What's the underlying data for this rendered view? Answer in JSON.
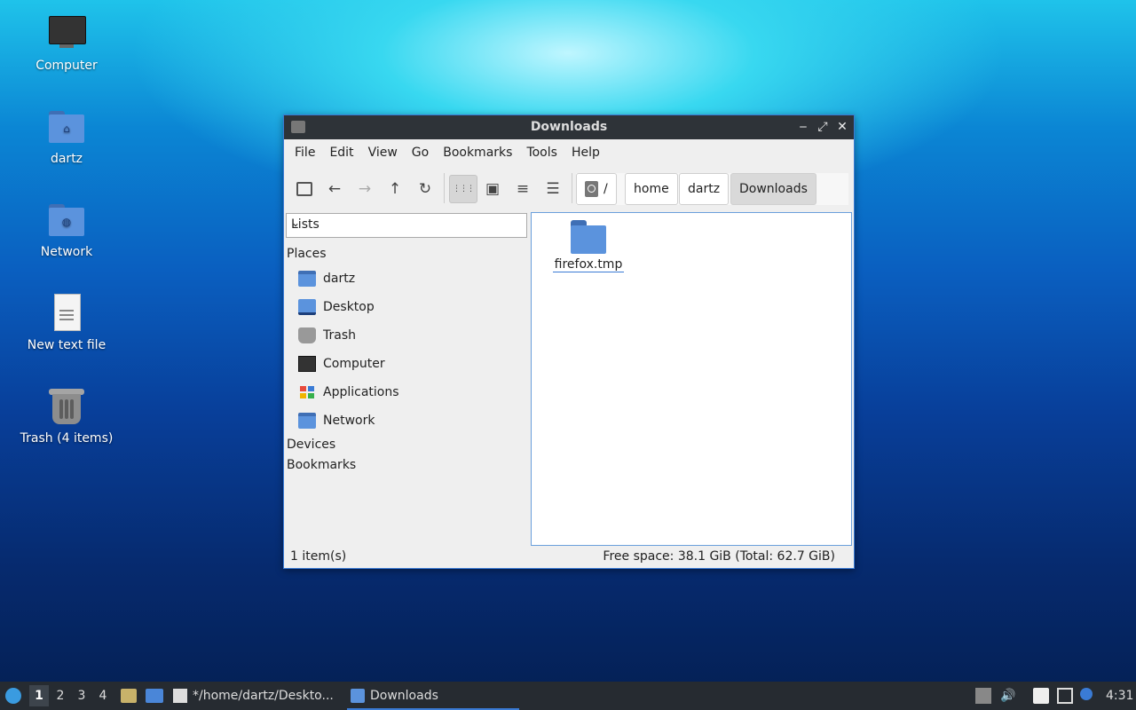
{
  "desktop": {
    "icons": [
      {
        "label": "Computer",
        "icon": "computer-icon"
      },
      {
        "label": "dartz",
        "icon": "home-folder-icon"
      },
      {
        "label": "Network",
        "icon": "network-folder-icon"
      },
      {
        "label": "New text file",
        "icon": "text-file-icon"
      },
      {
        "label": "Trash (4 items)",
        "icon": "trash-icon"
      }
    ]
  },
  "window": {
    "title": "Downloads",
    "controls": {
      "minimize": "‒",
      "maximize": "⤢",
      "close": "✕"
    },
    "menu": [
      "File",
      "Edit",
      "View",
      "Go",
      "Bookmarks",
      "Tools",
      "Help"
    ],
    "toolbar": {
      "icons": [
        "new-tab-icon",
        "back-icon",
        "forward-icon",
        "up-icon",
        "reload-icon",
        "icon-view-icon",
        "thumbnail-view-icon",
        "compact-view-icon",
        "detailed-view-icon"
      ],
      "glyphs": {
        "back": "←",
        "forward": "→",
        "up": "↑",
        "reload": "↻",
        "icon_view": "⋮⋮⋮",
        "thumb_view": "▣",
        "compact_view": "≡",
        "detail_view": "☰"
      }
    },
    "breadcrumb": {
      "root": "/",
      "items": [
        "home",
        "dartz",
        "Downloads"
      ]
    },
    "sidebar": {
      "selector": "Lists",
      "places_heading": "Places",
      "places": [
        {
          "label": "dartz",
          "icon": "home-folder-icon"
        },
        {
          "label": "Desktop",
          "icon": "desktop-icon"
        },
        {
          "label": "Trash",
          "icon": "trash-icon"
        },
        {
          "label": "Computer",
          "icon": "computer-icon"
        },
        {
          "label": "Applications",
          "icon": "applications-icon"
        },
        {
          "label": "Network",
          "icon": "network-icon"
        }
      ],
      "devices_heading": "Devices",
      "bookmarks_heading": "Bookmarks"
    },
    "files": [
      {
        "name": "firefox.tmp",
        "icon": "folder-icon"
      }
    ],
    "status": {
      "count": "1 item(s)",
      "space": "Free space: 38.1 GiB (Total: 62.7 GiB)"
    }
  },
  "taskbar": {
    "workspaces": [
      "1",
      "2",
      "3",
      "4"
    ],
    "active_workspace": "1",
    "tasks": [
      {
        "label": "*/home/dartz/Deskto...",
        "icon": "text-editor-icon"
      },
      {
        "label": "Downloads",
        "icon": "folder-icon"
      }
    ],
    "clock": "4:31"
  },
  "colors": {
    "accent": "#3a7bd5",
    "folder": "#5b93dd",
    "titlebar": "#2e3338",
    "taskbar": "#262b31"
  }
}
